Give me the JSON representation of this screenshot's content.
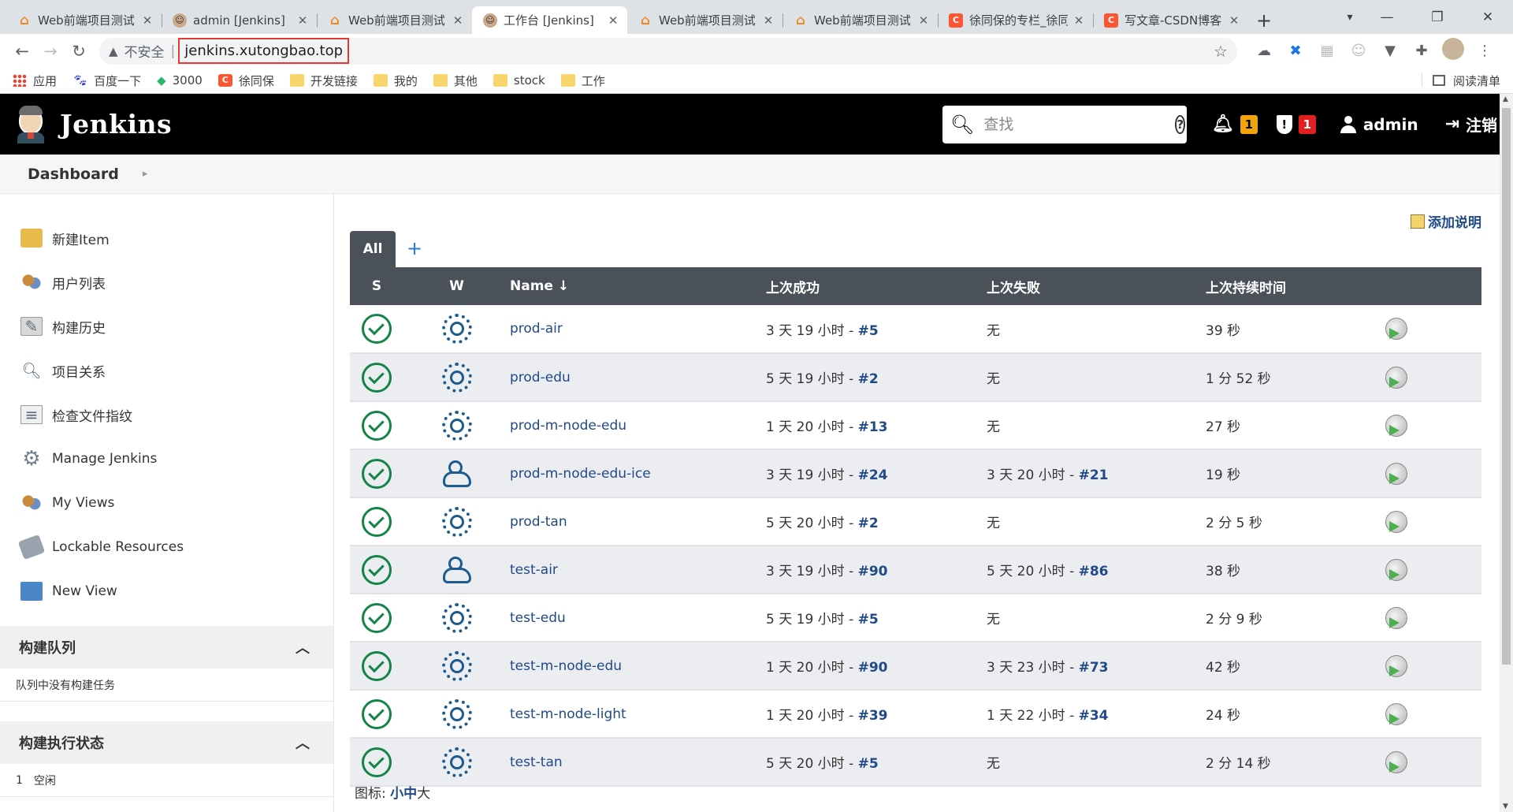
{
  "browser": {
    "tabs": [
      {
        "title": "Web前端项目测试",
        "icon": "web-icon"
      },
      {
        "title": "admin [Jenkins]",
        "icon": "jenkins-icon"
      },
      {
        "title": "Web前端项目测试",
        "icon": "web-icon"
      },
      {
        "title": "工作台 [Jenkins]",
        "icon": "jenkins-icon",
        "active": true
      },
      {
        "title": "Web前端项目测试",
        "icon": "web-icon"
      },
      {
        "title": "Web前端项目测试",
        "icon": "web-icon"
      },
      {
        "title": "徐同保的专栏_徐同",
        "icon": "csdn-icon"
      },
      {
        "title": "写文章-CSDN博客",
        "icon": "csdn-icon"
      }
    ],
    "security_label": "不安全",
    "url": "jenkins.xutongbao.top",
    "bookmarks": [
      {
        "label": "应用",
        "icon": "apps"
      },
      {
        "label": "百度一下",
        "icon": "baidu"
      },
      {
        "label": "3000",
        "icon": "green"
      },
      {
        "label": "徐同保",
        "icon": "c"
      },
      {
        "label": "开发链接",
        "icon": "folder"
      },
      {
        "label": "我的",
        "icon": "folder"
      },
      {
        "label": "其他",
        "icon": "folder"
      },
      {
        "label": "stock",
        "icon": "folder"
      },
      {
        "label": "工作",
        "icon": "folder"
      }
    ],
    "reading_list": "阅读清单"
  },
  "jenkins": {
    "title": "Jenkins",
    "search_placeholder": "查找",
    "notifications_count": "1",
    "security_count": "1",
    "user": "admin",
    "logout": "注销",
    "breadcrumb": "Dashboard",
    "sidebar_tasks": [
      {
        "label": "新建Item",
        "icon": "new-item-icon"
      },
      {
        "label": "用户列表",
        "icon": "users-icon"
      },
      {
        "label": "构建历史",
        "icon": "build-history-icon"
      },
      {
        "label": "项目关系",
        "icon": "project-relationship-icon"
      },
      {
        "label": "检查文件指纹",
        "icon": "fingerprint-icon"
      },
      {
        "label": "Manage Jenkins",
        "icon": "gear-icon"
      },
      {
        "label": "My Views",
        "icon": "users-icon"
      },
      {
        "label": "Lockable Resources",
        "icon": "lock-icon"
      },
      {
        "label": "New View",
        "icon": "folder-icon"
      }
    ],
    "build_queue": {
      "title": "构建队列",
      "empty_text": "队列中没有构建任务"
    },
    "executor_status": {
      "title": "构建执行状态",
      "executors": [
        {
          "num": "1",
          "state": "空闲"
        }
      ]
    },
    "add_description": "添加说明",
    "views": [
      {
        "label": "All",
        "active": true
      }
    ],
    "add_view": "+",
    "table": {
      "headers": {
        "s": "S",
        "w": "W",
        "name": "Name ↓",
        "last_success": "上次成功",
        "last_failure": "上次失败",
        "last_duration": "上次持续时间"
      },
      "rows": [
        {
          "name": "prod-air",
          "weather": "sunny",
          "ls_time": "3 天 19 小时 - ",
          "ls_build": "#5",
          "lf_time": "无",
          "lf_build": "",
          "duration": "39 秒"
        },
        {
          "name": "prod-edu",
          "weather": "sunny",
          "ls_time": "5 天 19 小时 - ",
          "ls_build": "#2",
          "lf_time": "无",
          "lf_build": "",
          "duration": "1 分 52 秒"
        },
        {
          "name": "prod-m-node-edu",
          "weather": "sunny",
          "ls_time": "1 天 20 小时 - ",
          "ls_build": "#13",
          "lf_time": "无",
          "lf_build": "",
          "duration": "27 秒"
        },
        {
          "name": "prod-m-node-edu-ice",
          "weather": "partly-cloudy",
          "ls_time": "3 天 19 小时 - ",
          "ls_build": "#24",
          "lf_time": "3 天 20 小时 - ",
          "lf_build": "#21",
          "duration": "19 秒"
        },
        {
          "name": "prod-tan",
          "weather": "sunny",
          "ls_time": "5 天 20 小时 - ",
          "ls_build": "#2",
          "lf_time": "无",
          "lf_build": "",
          "duration": "2 分 5 秒"
        },
        {
          "name": "test-air",
          "weather": "partly-cloudy",
          "ls_time": "3 天 19 小时 - ",
          "ls_build": "#90",
          "lf_time": "5 天 20 小时 - ",
          "lf_build": "#86",
          "duration": "38 秒"
        },
        {
          "name": "test-edu",
          "weather": "sunny",
          "ls_time": "5 天 19 小时 - ",
          "ls_build": "#5",
          "lf_time": "无",
          "lf_build": "",
          "duration": "2 分 9 秒"
        },
        {
          "name": "test-m-node-edu",
          "weather": "sunny",
          "ls_time": "1 天 20 小时 - ",
          "ls_build": "#90",
          "lf_time": "3 天 23 小时 - ",
          "lf_build": "#73",
          "duration": "42 秒"
        },
        {
          "name": "test-m-node-light",
          "weather": "sunny",
          "ls_time": "1 天 20 小时 - ",
          "ls_build": "#39",
          "lf_time": "1 天 22 小时 - ",
          "lf_build": "#34",
          "duration": "24 秒"
        },
        {
          "name": "test-tan",
          "weather": "sunny",
          "ls_time": "5 天 20 小时 - ",
          "ls_build": "#5",
          "lf_time": "无",
          "lf_build": "",
          "duration": "2 分 14 秒"
        }
      ]
    },
    "legend": {
      "label": "图标:",
      "small": "小",
      "medium": "中",
      "large": "大"
    }
  }
}
